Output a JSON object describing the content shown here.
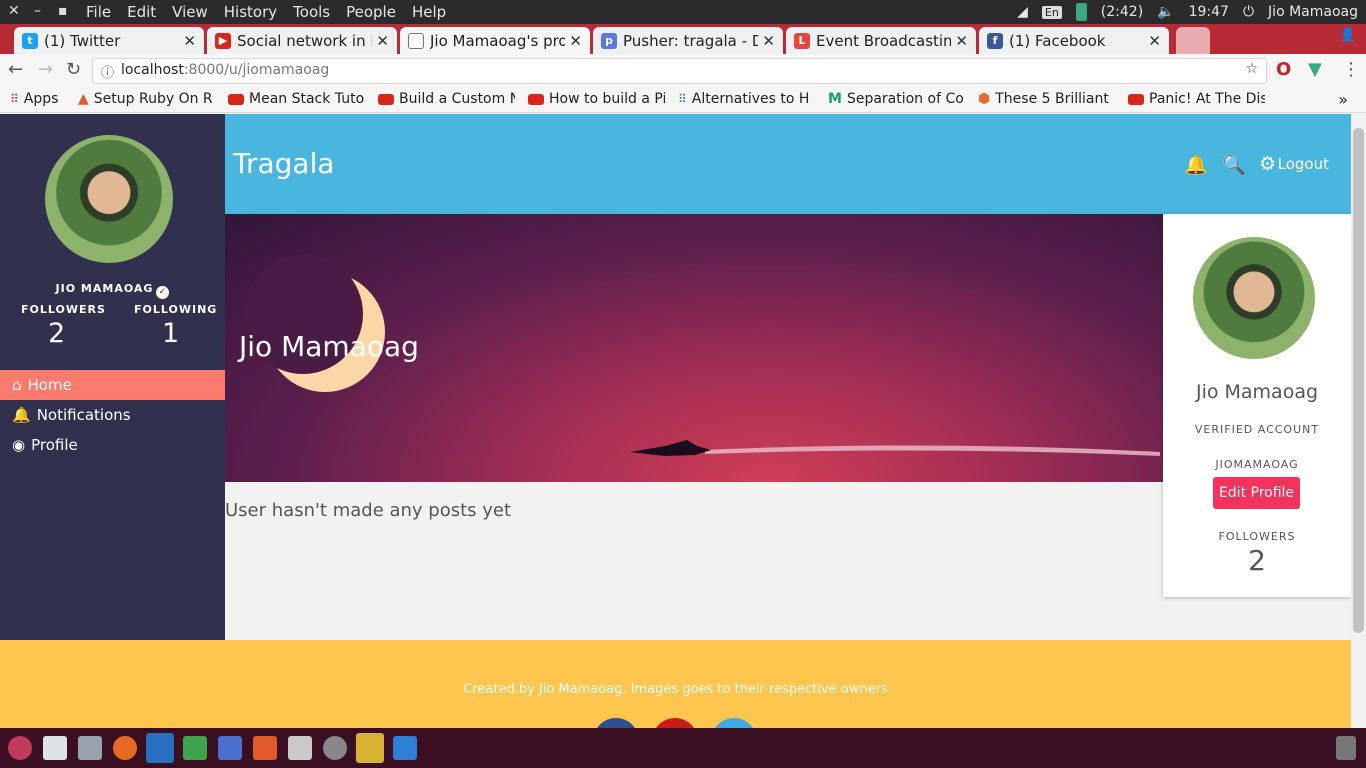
{
  "os": {
    "menu": [
      "File",
      "Edit",
      "View",
      "History",
      "Tools",
      "People",
      "Help"
    ],
    "lang": "En",
    "battery": "(2:42)",
    "clock": "19:47",
    "user": "Jio Mamaoag"
  },
  "tabs": [
    {
      "title": "(1) Twitter",
      "icon": "twitter-icon",
      "color": "#1da1f2"
    },
    {
      "title": "Social network in La",
      "icon": "youtube-icon",
      "color": "#d8261b"
    },
    {
      "title": "Jio Mamaoag's pro",
      "icon": "page-icon",
      "color": "#555555"
    },
    {
      "title": "Pusher: tragala - De",
      "icon": "pusher-icon",
      "color": "#5a78e0"
    },
    {
      "title": "Event Broadcasting",
      "icon": "laravel-icon",
      "color": "#e8453c"
    },
    {
      "title": "(1) Facebook",
      "icon": "facebook-icon",
      "color": "#3b5998"
    }
  ],
  "address": {
    "host": "localhost",
    "path": ":8000/u/jiomamaoag"
  },
  "bookmarks": [
    "Apps",
    "Setup Ruby On R",
    "Mean Stack Tutor",
    "Build a Custom N",
    "How to build a Pi",
    "Alternatives to H",
    "Separation of Co",
    "These 5 Brilliant",
    "Panic! At The Dis"
  ],
  "sidebar": {
    "name": "JIO MAMAOAG",
    "followers_label": "FOLLOWERS",
    "followers": "2",
    "following_label": "FOLLOWING",
    "following": "1",
    "nav": [
      "Home",
      "Notifications",
      "Profile"
    ]
  },
  "header": {
    "brand": "Tragala",
    "logout": "Logout"
  },
  "hero": {
    "name": "Jio Mamaoag"
  },
  "main": {
    "empty": "User hasn't made any posts yet"
  },
  "card": {
    "name": "Jio Mamaoag",
    "verified": "VERIFIED ACCOUNT",
    "username": "JIOMAMAOAG",
    "edit": "Edit Profile",
    "followers_label": "FOLLOWERS",
    "followers": "2"
  },
  "footer": {
    "text": "Created by Jio Mamaoag. Images goes to their respective owners"
  },
  "colors": {
    "sidebar": "#31304f",
    "header": "#48b6df",
    "accent": "#fd7a6f",
    "button": "#f5325c",
    "footer": "#fec64e"
  }
}
